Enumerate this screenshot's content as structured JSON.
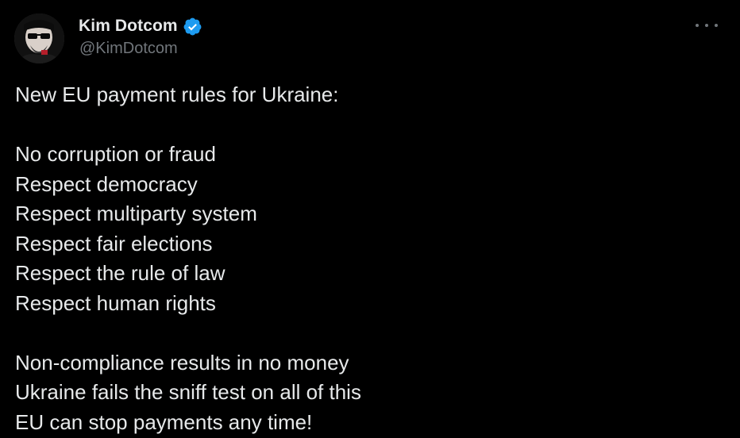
{
  "author": {
    "display_name": "Kim Dotcom",
    "handle": "@KimDotcom",
    "verified_color": "#1d9bf0"
  },
  "menu": {
    "icon": "more-horizontal-icon"
  },
  "tweet": {
    "lines_intro": [
      "New EU payment rules for Ukraine:"
    ],
    "lines_rules": [
      "No corruption or fraud",
      "Respect democracy",
      "Respect multiparty system",
      "Respect fair elections",
      "Respect the rule of law",
      "Respect human rights"
    ],
    "lines_outro": [
      "Non-compliance results in no money",
      "Ukraine fails the sniff test on all of this",
      "EU can stop payments any time!"
    ]
  },
  "colors": {
    "background": "#000000",
    "text": "#e7e9ea",
    "secondary": "#71767b"
  }
}
